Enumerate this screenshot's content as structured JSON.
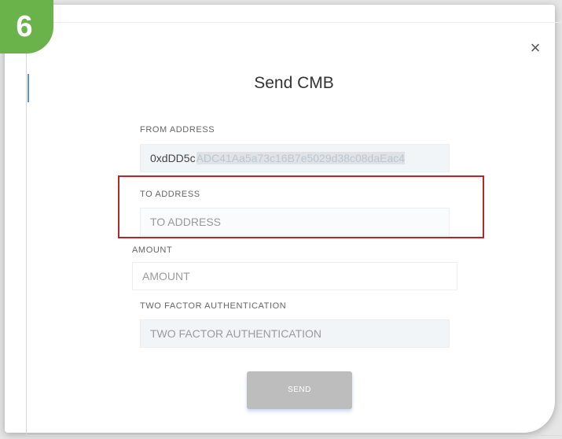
{
  "step_badge": "6",
  "close_icon": "×",
  "modal": {
    "title": "Send CMB",
    "from_address": {
      "label": "FROM ADDRESS",
      "value_visible": "0xdDD5c",
      "value_rest": "ADC41Aa5a73c16B7e5029d38c08daEac4"
    },
    "to_address": {
      "label": "TO ADDRESS",
      "placeholder": "TO ADDRESS"
    },
    "amount": {
      "label": "AMOUNT",
      "placeholder": "AMOUNT"
    },
    "two_factor": {
      "label": "TWO FACTOR AUTHENTICATION",
      "placeholder": "TWO FACTOR AUTHENTICATION"
    },
    "send_label": "SEND"
  },
  "colors": {
    "badge": "#69b34a",
    "highlight": "#b7262a",
    "send_button": "#bdbdbd"
  }
}
